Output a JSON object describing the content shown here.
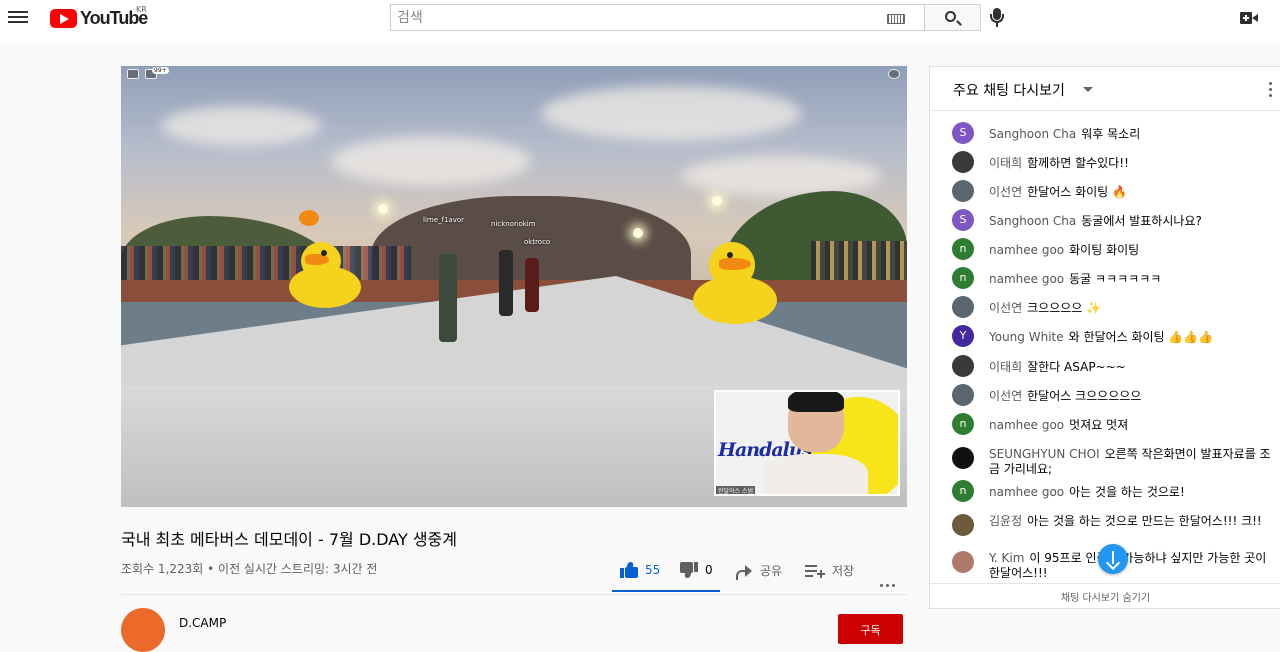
{
  "header": {
    "logo_text": "YouTube",
    "country_code": "KR",
    "search_placeholder": "검색",
    "icons": [
      "menu-icon",
      "youtube-logo",
      "keyboard-icon",
      "search-icon",
      "mic-icon",
      "create-video-icon"
    ]
  },
  "player": {
    "overlay_badge": "99+",
    "name_tags": [
      "lime_f1avor",
      "nicknonokim",
      "oktroco"
    ],
    "pip_logo_text": "Handalus",
    "pip_caption": "한달어스 스냅"
  },
  "video": {
    "title": "국내 최초 메타버스 데모데이 - 7월 D.DAY 생중계",
    "meta": "조회수 1,223회 • 이전 실시간 스트리밍: 3시간 전",
    "likes": "55",
    "dislikes": "0",
    "share_label": "공유",
    "save_label": "저장",
    "accent_color": "#065fd4"
  },
  "channel": {
    "name": "D.CAMP",
    "subscribe_label": "구독",
    "subscribe_color": "#cc0000"
  },
  "chat": {
    "title": "주요 채팅 다시보기",
    "footer": "채팅 다시보기 숨기기",
    "messages": [
      {
        "author": "Sanghoon Cha",
        "text": "워후 목소리",
        "initial": "S",
        "color": "#7e57c2"
      },
      {
        "author": "이태희",
        "text": "함께하면 할수있다!!",
        "initial": "",
        "color": "#3a3a3a"
      },
      {
        "author": "이선연",
        "text": "한달어스 화이팅 🔥",
        "initial": "",
        "color": "#5b6770"
      },
      {
        "author": "Sanghoon Cha",
        "text": "동굴에서 발표하시나요?",
        "initial": "S",
        "color": "#7e57c2"
      },
      {
        "author": "namhee goo",
        "text": "화이팅 화이팅",
        "initial": "n",
        "color": "#2e7d32"
      },
      {
        "author": "namhee goo",
        "text": "동굴 ㅋㅋㅋㅋㅋㅋ",
        "initial": "n",
        "color": "#2e7d32"
      },
      {
        "author": "이선연",
        "text": "크으으으으 ✨",
        "initial": "",
        "color": "#5b6770"
      },
      {
        "author": "Young White",
        "text": "와 한달어스 화이팅 👍👍👍",
        "initial": "Y",
        "color": "#4527a0"
      },
      {
        "author": "이태희",
        "text": "잘한다 ASAP~~~",
        "initial": "",
        "color": "#3a3a3a"
      },
      {
        "author": "이선연",
        "text": "한달어스 크으으으으으",
        "initial": "",
        "color": "#5b6770"
      },
      {
        "author": "namhee goo",
        "text": "멋져요 멋져",
        "initial": "n",
        "color": "#2e7d32"
      },
      {
        "author": "SEUNGHYUN CHOI",
        "text": "오른쪽 작은화면이 발표자료를 조금 가리네요;",
        "initial": "",
        "color": "#111111"
      },
      {
        "author": "namhee goo",
        "text": "아는 것을 하는 것으로!",
        "initial": "n",
        "color": "#2e7d32"
      },
      {
        "author": "김윤정",
        "text": "아는 것을 하는 것으로 만드는 한달어스!!! 크!!",
        "initial": "",
        "color": "#6d5a3a"
      },
      {
        "author": "Y. Kim",
        "text": "이 95프로 인증이 가능하냐 싶지만 가능한 곳이 한달어스!!!",
        "initial": "",
        "color": "#b07a6a"
      }
    ]
  }
}
